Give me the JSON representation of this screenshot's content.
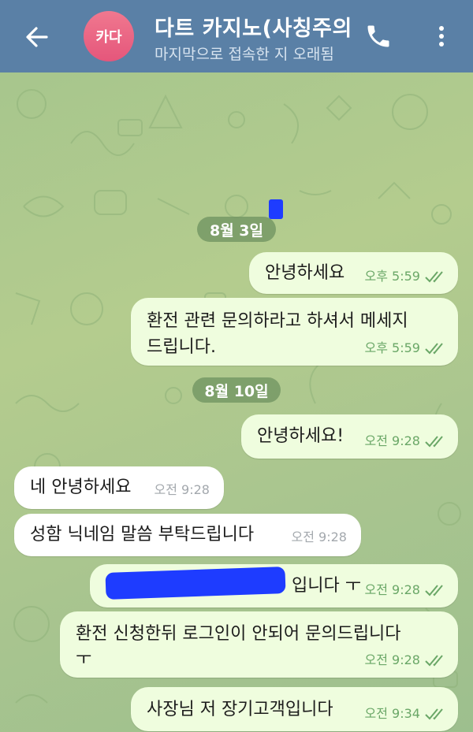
{
  "header": {
    "avatar_text": "카다",
    "title": "다트 카지노(사칭주의",
    "subtitle": "마지막으로 접속한 지 오래됨",
    "icons": [
      "back-arrow-icon",
      "phone-icon",
      "more-vert-icon"
    ]
  },
  "dates": [
    "8월 3일",
    "8월 10일"
  ],
  "messages": [
    {
      "dir": "out",
      "text": "안녕하세요",
      "time": "오후 5:59"
    },
    {
      "dir": "out",
      "line1": "환전 관련 문의하라고 하셔서 메세지",
      "line2": "드립니다.",
      "time": "오후 5:59"
    },
    {
      "dir": "out",
      "text": "안녕하세요!",
      "time": "오전 9:28"
    },
    {
      "dir": "in",
      "text": "네 안녕하세요",
      "time": "오전 9:28"
    },
    {
      "dir": "in",
      "text": "성함 닉네임 말씀 부탁드립니다",
      "time": "오전 9:28"
    },
    {
      "dir": "out",
      "text": "입니다 ㅜ",
      "time": "오전 9:28"
    },
    {
      "dir": "out",
      "line1": "환전 신청한뒤 로그인이 안되어 문의드립니다",
      "line2": "ㅜ",
      "time": "오전 9:28"
    },
    {
      "dir": "out",
      "text": "사장님 저 장기고객입니다",
      "time": "오전 9:34"
    }
  ],
  "colors": {
    "header": "#5a80a6",
    "outgoing_bubble": "#effdde",
    "incoming_bubble": "#ffffff",
    "accent_green": "#6aa767",
    "redaction": "#1e3cff"
  }
}
